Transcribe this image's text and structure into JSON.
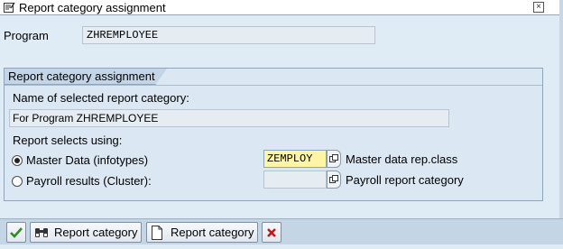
{
  "window": {
    "title": "Report category assignment",
    "close_glyph": "×",
    "icons": {
      "title": "window-menu-icon",
      "close": "close-icon"
    }
  },
  "program": {
    "label": "Program",
    "value": "ZHREMPLOYEE"
  },
  "group": {
    "title": "Report category assignment",
    "name_label": "Name of selected report category:",
    "name_value": "For Program ZHREMPLOYEE",
    "selects_label": "Report selects using:",
    "options": [
      {
        "label": "Master Data (infotypes)",
        "selected": true,
        "value": "ZEMPLOY",
        "description": "Master data rep.class"
      },
      {
        "label": "Payroll results (Cluster):",
        "selected": false,
        "value": "",
        "description": "Payroll report category"
      }
    ]
  },
  "toolbar": {
    "buttons": [
      {
        "label": "",
        "icon": "checkmark-icon"
      },
      {
        "label": "Report category",
        "icon": "binoculars-icon"
      },
      {
        "label": "Report category",
        "icon": "new-document-icon"
      },
      {
        "label": "",
        "icon": "cancel-icon"
      }
    ]
  },
  "colors": {
    "background": "#dfebf5",
    "group_background": "#dbe7f2",
    "input_highlight": "#fff6a5",
    "checkmark": "#2f8a1f",
    "cancel": "#c01818"
  }
}
